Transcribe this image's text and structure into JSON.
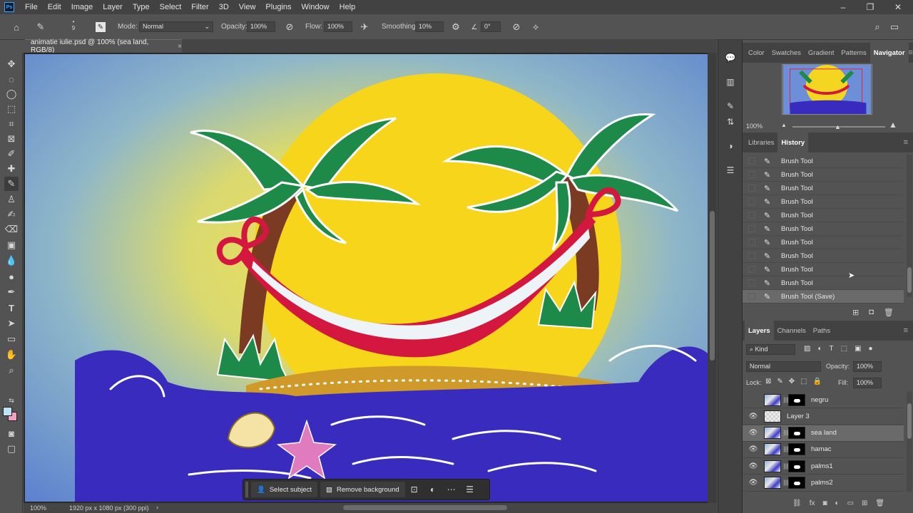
{
  "app": {
    "logo": "Ps"
  },
  "menu": [
    "File",
    "Edit",
    "Image",
    "Layer",
    "Type",
    "Select",
    "Filter",
    "3D",
    "View",
    "Plugins",
    "Window",
    "Help"
  ],
  "window_controls": {
    "minimize": "–",
    "restore": "❐",
    "close": "✕"
  },
  "options_bar": {
    "brush_size": "9",
    "mode_label": "Mode:",
    "mode_value": "Normal",
    "opacity_label": "Opacity:",
    "opacity_value": "100%",
    "flow_label": "Flow:",
    "flow_value": "100%",
    "smoothing_label": "Smoothing:",
    "smoothing_value": "10%",
    "angle_value": "0°"
  },
  "document": {
    "tab_title": "animatie iulie.psd @ 100% (sea land, RGB/8)",
    "close": "×"
  },
  "status_bar": {
    "zoom": "100%",
    "info": "1920 px x 1080 px (300 ppi)",
    "arrow": "›"
  },
  "context_bar": {
    "select_subject": "Select subject",
    "remove_background": "Remove background"
  },
  "top_panel": {
    "tabs": [
      "Color",
      "Swatches",
      "Gradient",
      "Patterns",
      "Navigator"
    ],
    "active_tab": "Navigator",
    "zoom": "100%"
  },
  "history_panel": {
    "tabs": [
      "Libraries",
      "History"
    ],
    "active_tab": "History",
    "items": [
      "Brush Tool",
      "Brush Tool",
      "Brush Tool",
      "Brush Tool",
      "Brush Tool",
      "Brush Tool",
      "Brush Tool",
      "Brush Tool",
      "Brush Tool",
      "Brush Tool",
      "Brush Tool (Save)"
    ],
    "selected_index": 10
  },
  "layers_panel": {
    "tabs": [
      "Layers",
      "Channels",
      "Paths"
    ],
    "active_tab": "Layers",
    "filter_kind": "Kind",
    "blend_mode": "Normal",
    "opacity_label": "Opacity:",
    "opacity_value": "100%",
    "lock_label": "Lock:",
    "fill_label": "Fill:",
    "fill_value": "100%",
    "layers": [
      {
        "name": "negru",
        "visible": false,
        "has_mask": true,
        "selected": false
      },
      {
        "name": "Layer 3",
        "visible": true,
        "has_mask": false,
        "selected": false
      },
      {
        "name": "sea land",
        "visible": true,
        "has_mask": true,
        "selected": true
      },
      {
        "name": "hamac",
        "visible": true,
        "has_mask": true,
        "selected": false
      },
      {
        "name": "palms1",
        "visible": true,
        "has_mask": true,
        "selected": false
      },
      {
        "name": "palms2",
        "visible": true,
        "has_mask": true,
        "selected": false
      }
    ]
  },
  "colors": {
    "foreground": "#bde3f7",
    "background": "#f59fc3",
    "accent": "#31a8ff"
  }
}
